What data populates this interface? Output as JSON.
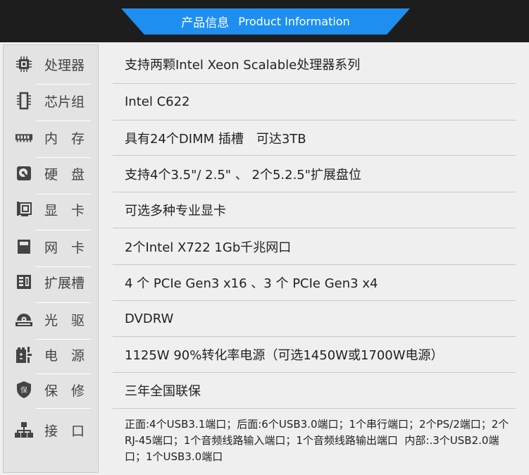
{
  "header": {
    "title_cn": "产品信息",
    "title_en": "Product Information"
  },
  "specs": [
    {
      "label": "处理器",
      "icon": "cpu-icon",
      "value": "支持两颗Intel Xeon Scalable处理器系列"
    },
    {
      "label": "芯片组",
      "icon": "chipset-icon",
      "value": "Intel C622"
    },
    {
      "label": "内　存",
      "icon": "memory-icon",
      "value": "具有24个DIMM 插槽　可达3TB"
    },
    {
      "label": "硬　盘",
      "icon": "hdd-icon",
      "value": "支持4个3.5\"/ 2.5\" 、 2个5.2.5\"扩展盘位"
    },
    {
      "label": "显　卡",
      "icon": "gpu-icon",
      "value": "可选多种专业显卡"
    },
    {
      "label": "网　卡",
      "icon": "nic-icon",
      "value": "2个Intel X722 1Gb千兆网口"
    },
    {
      "label": "扩展槽",
      "icon": "expansion-slot-icon",
      "value": "4 个 PCIe Gen3 x16 、3 个 PCIe Gen3 x4"
    },
    {
      "label": "光　驱",
      "icon": "optical-drive-icon",
      "value": "DVDRW"
    },
    {
      "label": "电　源",
      "icon": "power-supply-icon",
      "value": "1125W 90%转化率电源（可选1450W或1700W电源）"
    },
    {
      "label": "保　修",
      "icon": "warranty-shield-icon",
      "value": "三年全国联保"
    },
    {
      "label": "接　口",
      "icon": "network-ports-icon",
      "value": "正面:4个USB3.1端口；后面:6个USB3.0端口；1个串行端口；2个PS/2端口；2个RJ-45端口；1个音频线路输入端口；1个音频线路输出端口  内部:.3个USB2.0端口；1个USB3.0端口"
    }
  ]
}
